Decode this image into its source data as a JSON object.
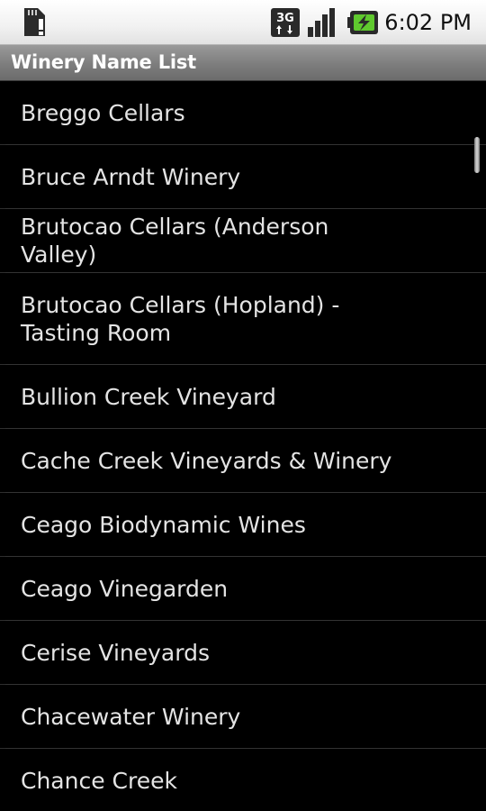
{
  "status_bar": {
    "time": "6:02 PM",
    "network_label": "3G",
    "icons": [
      "sd-card-alert-icon",
      "3g-data-icon",
      "signal-strength-icon",
      "battery-charging-icon"
    ],
    "colors": {
      "battery_fill": "#5fc92e",
      "background": "#f4f4f4"
    }
  },
  "title_bar": {
    "title": "Winery Name List",
    "colors": {
      "background": "#858585",
      "text": "#ffffff"
    }
  },
  "winery_list": {
    "items": [
      "Breggo Cellars",
      "Bruce Arndt Winery",
      "Brutocao Cellars (Anderson Valley)",
      "Brutocao Cellars (Hopland) - Tasting Room",
      "Bullion Creek Vineyard",
      "Cache Creek Vineyards & Winery",
      "Ceago Biodynamic Wines",
      "Ceago Vinegarden",
      "Cerise Vineyards",
      "Chacewater Winery",
      "Chance Creek"
    ],
    "colors": {
      "background": "#000000",
      "text": "#e4e4e4",
      "divider": "#333333"
    }
  }
}
